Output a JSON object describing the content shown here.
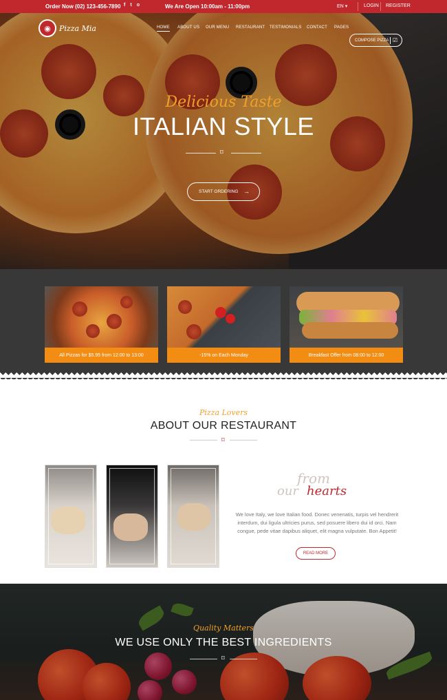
{
  "topbar": {
    "phone": "Order Now (02) 123-456-7890",
    "social": [
      "f",
      "t",
      "o"
    ],
    "hours": "We Are Open 10:00am - 11:00pm",
    "language": "EN",
    "login": "LOGIN",
    "register": "REGISTER"
  },
  "header": {
    "logo_text": "Pizza Mia",
    "nav": [
      "HOME",
      "ABOUT US",
      "OUR MENU",
      "RESTAURANT",
      "TESTIMONIALS",
      "CONTACT",
      "PAGES"
    ],
    "compose_label": "COMPOSE PIZZA"
  },
  "hero": {
    "script": "Delicious Taste",
    "title": "ITALIAN STYLE",
    "cta": "START ORDERING"
  },
  "offers": [
    {
      "label": "All Pizzas for $5.95 from 12:00 to 13:00"
    },
    {
      "label": "-15% on Each Monday"
    },
    {
      "label": "Breakfast Offer from 08:00 to 12:00"
    }
  ],
  "about": {
    "script": "Pizza Lovers",
    "title": "ABOUT OUR RESTAURANT",
    "from": "from",
    "our": "our",
    "hearts": "hearts",
    "text": "We love Italy, we love Italian food. Donec venenatis, turpis vel hendrerit interdum, dui ligula ultricies purus, sed posuere libero dui id orci. Nam congue, pede vitae dapibus aliquet, elit magna vulputate. Bon Appetit!",
    "read_more": "READ MORE"
  },
  "ingredients": {
    "script": "Quality Matters",
    "title": "WE USE ONLY THE BEST INGREDIENTS"
  },
  "colors": {
    "brand_red": "#c0282d",
    "accent_orange": "#f28c13",
    "script_gold": "#f0a02a",
    "dark_band": "#383838"
  }
}
